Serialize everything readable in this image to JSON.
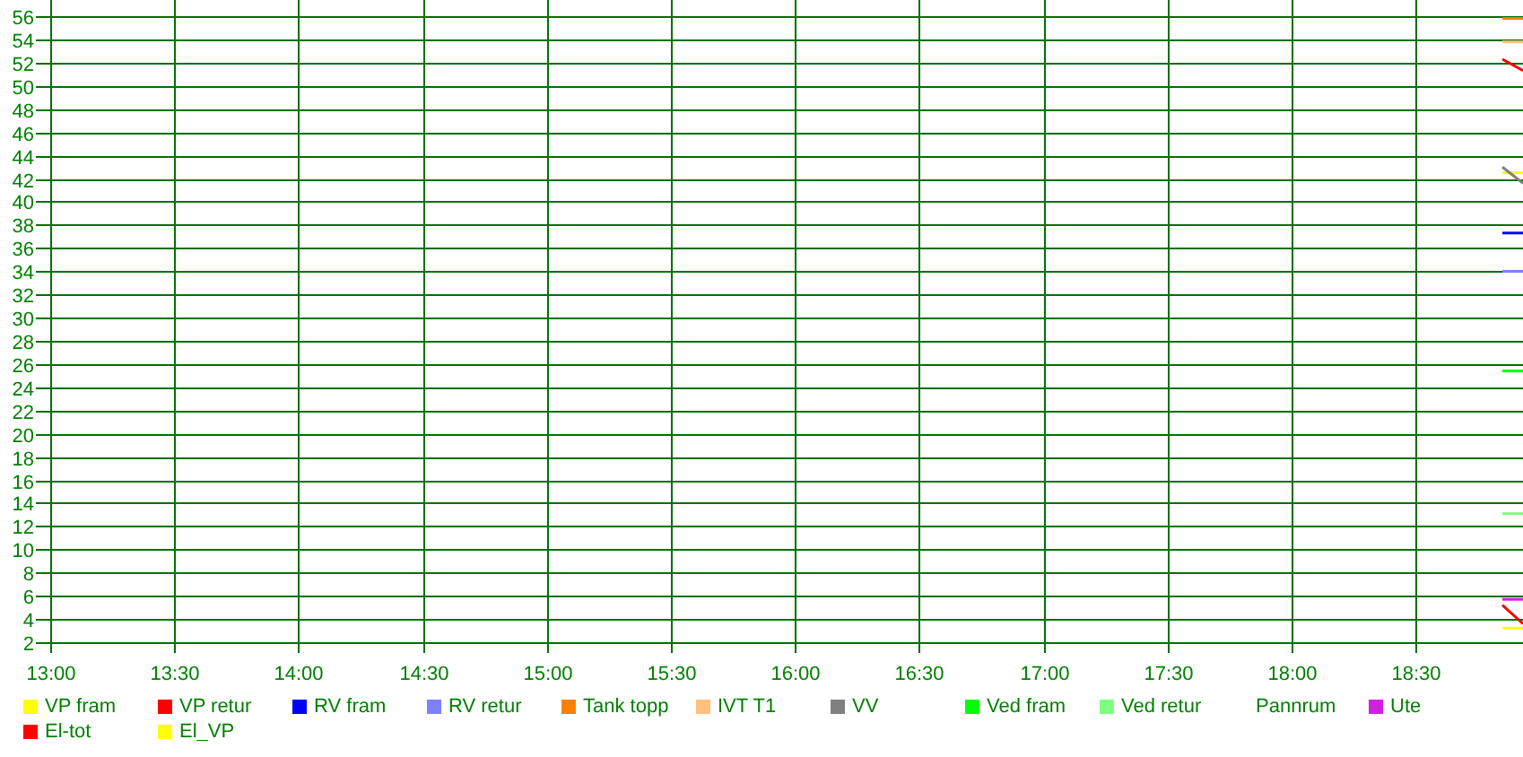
{
  "chart": {
    "chart_data": {
      "type": "line",
      "grid": true,
      "x": [
        18.85,
        18.933
      ],
      "xlim": [
        13,
        18.933
      ],
      "ylim": [
        2,
        57.4
      ],
      "xticks": [
        {
          "value": 13,
          "label": "13:00"
        },
        {
          "value": 13.5,
          "label": "13:30"
        },
        {
          "value": 14,
          "label": "14:00"
        },
        {
          "value": 14.5,
          "label": "14:30"
        },
        {
          "value": 15,
          "label": "15:00"
        },
        {
          "value": 15.5,
          "label": "15:30"
        },
        {
          "value": 16,
          "label": "16:00"
        },
        {
          "value": 16.5,
          "label": "16:30"
        },
        {
          "value": 17,
          "label": "17:00"
        },
        {
          "value": 17.5,
          "label": "17:30"
        },
        {
          "value": 18,
          "label": "18:00"
        },
        {
          "value": 18.5,
          "label": "18:30"
        }
      ],
      "yticks": [
        2,
        4,
        6,
        8,
        10,
        12,
        14,
        16,
        18,
        20,
        22,
        24,
        26,
        28,
        30,
        32,
        34,
        36,
        38,
        40,
        42,
        44,
        46,
        48,
        50,
        52,
        54,
        56
      ],
      "series": [
        {
          "name": "VP fram",
          "color": "#ffff00",
          "values": [
            42.5,
            42.5
          ]
        },
        {
          "name": "VP retur",
          "color": "#ff0000",
          "values": [
            52.3,
            51.3
          ]
        },
        {
          "name": "RV fram",
          "color": "#0000ff",
          "values": [
            37.3,
            37.3
          ]
        },
        {
          "name": "RV retur",
          "color": "#8080ff",
          "values": [
            34,
            34
          ]
        },
        {
          "name": "Tank topp",
          "color": "#ff8000",
          "values": [
            55.8,
            55.8
          ]
        },
        {
          "name": "IVT T1",
          "color": "#ffc080",
          "values": [
            53.8,
            53.8
          ]
        },
        {
          "name": "VV",
          "color": "#808080",
          "values": [
            43,
            41.6
          ]
        },
        {
          "name": "Ved fram",
          "color": "#00ff00",
          "values": [
            25.4,
            25.4
          ]
        },
        {
          "name": "Ved retur",
          "color": "#80ff80",
          "values": [
            13.1,
            13.1
          ]
        },
        {
          "name": "Pannrum",
          "values": [
            null,
            null
          ]
        },
        {
          "name": "Ute",
          "color": "#d020e0",
          "values": [
            5.7,
            5.7
          ]
        },
        {
          "name": "El-tot",
          "color": "#ff0000",
          "values": [
            5.2,
            3.6
          ]
        },
        {
          "name": "El_VP",
          "color": "#ffff00",
          "values": [
            3.2,
            3.2
          ]
        }
      ]
    }
  }
}
